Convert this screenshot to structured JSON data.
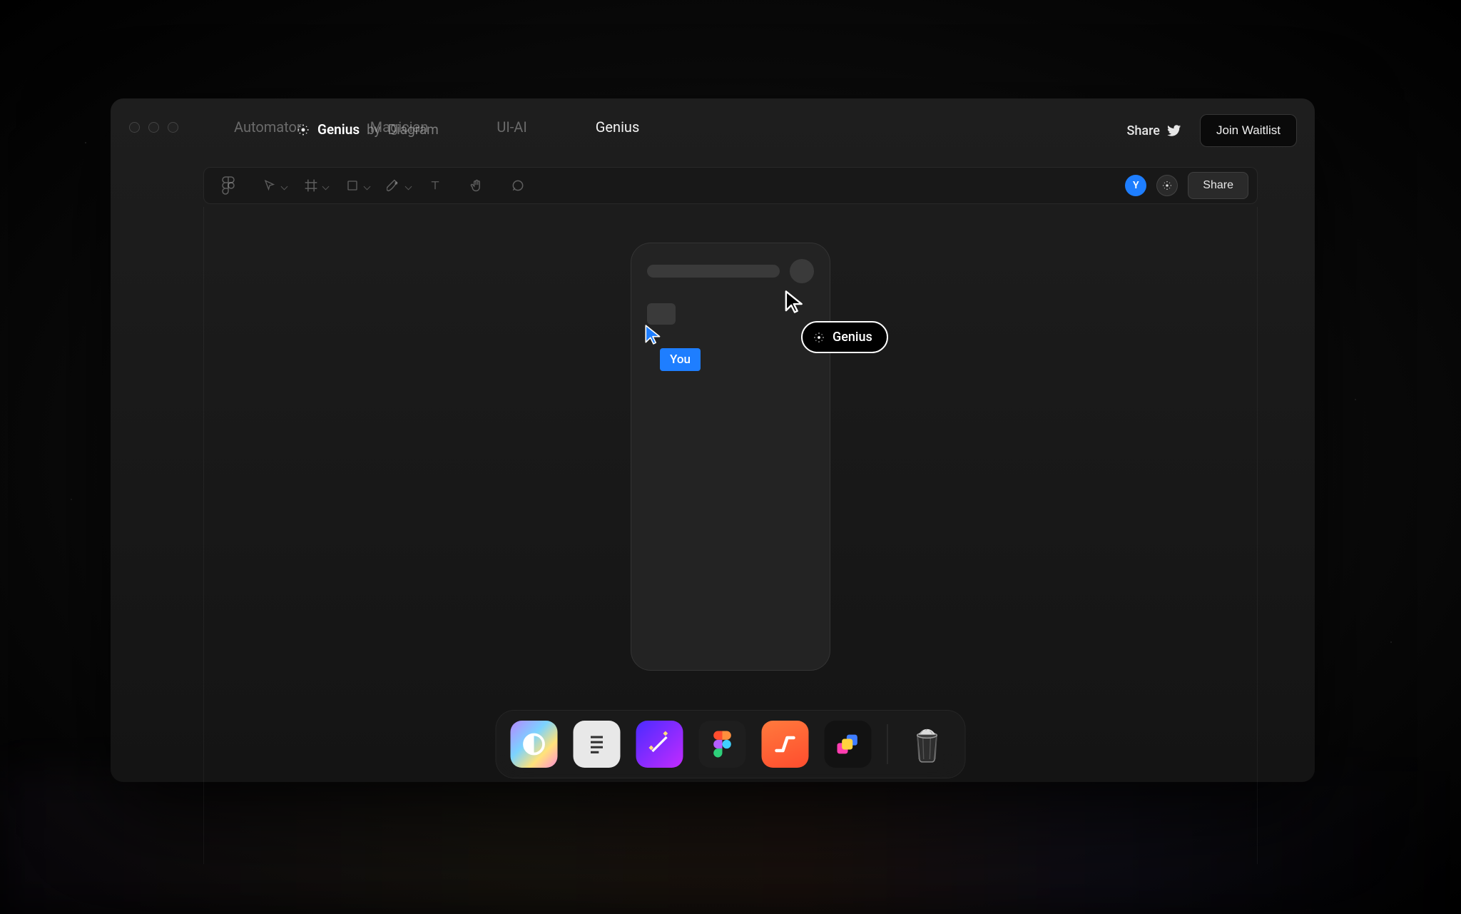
{
  "brand": {
    "name": "Genius",
    "by_prefix": "by",
    "by_name": "Diagram"
  },
  "actions": {
    "share": "Share",
    "join_waitlist": "Join Waitlist"
  },
  "tabs": [
    {
      "label": "Automator",
      "active": false
    },
    {
      "label": "Magician",
      "active": false
    },
    {
      "label": "UI-AI",
      "active": false
    },
    {
      "label": "Genius",
      "active": true
    }
  ],
  "toolbar": {
    "avatar_initial": "Y",
    "share_button": "Share"
  },
  "canvas": {
    "user_cursor_label": "You",
    "ai_cursor_label": "Genius"
  },
  "dock": {
    "items": [
      {
        "name": "appearance-app"
      },
      {
        "name": "notes-app"
      },
      {
        "name": "magician-app"
      },
      {
        "name": "figma-app"
      },
      {
        "name": "automator-app"
      },
      {
        "name": "shapes-app"
      }
    ],
    "trash": "Trash"
  },
  "colors": {
    "accent_blue": "#1e7eff",
    "bg_dark": "#141414"
  }
}
